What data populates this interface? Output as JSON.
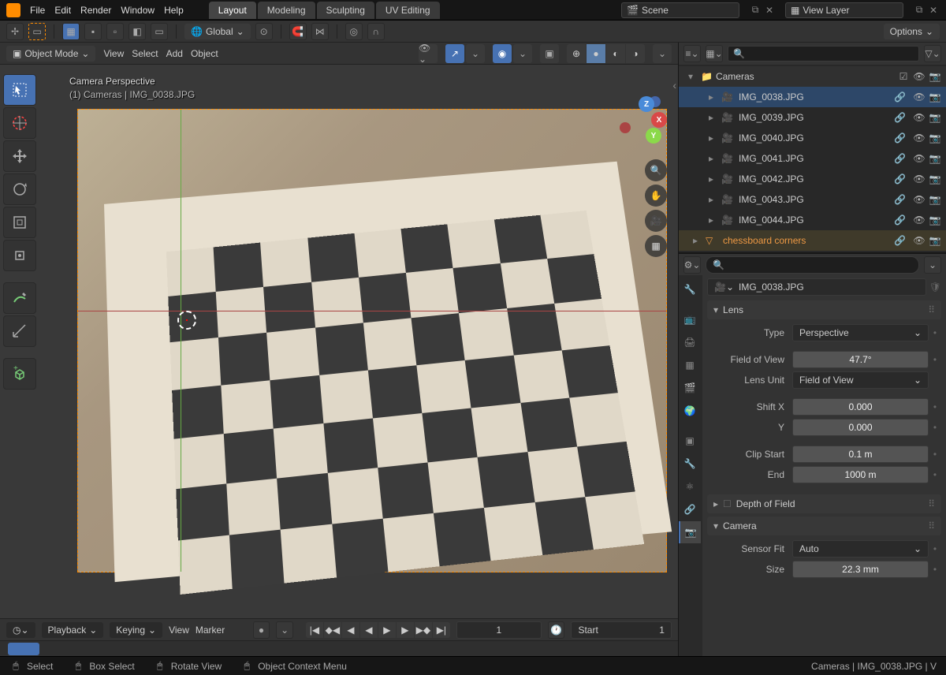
{
  "top_menu": {
    "items": [
      "File",
      "Edit",
      "Render",
      "Window",
      "Help"
    ],
    "tabs": [
      "Layout",
      "Modeling",
      "Sculpting",
      "UV Editing"
    ],
    "active_tab": 0,
    "scene_label": "Scene",
    "view_layer_label": "View Layer"
  },
  "toolbar": {
    "orientation": "Global",
    "options_label": "Options"
  },
  "viewport_header": {
    "mode": "Object Mode",
    "menus": [
      "View",
      "Select",
      "Add",
      "Object"
    ]
  },
  "viewport": {
    "title": "Camera Perspective",
    "subtitle": "(1) Cameras | IMG_0038.JPG"
  },
  "outliner": {
    "collection": "Cameras",
    "items": [
      {
        "name": "IMG_0038.JPG",
        "selected": true
      },
      {
        "name": "IMG_0039.JPG",
        "selected": false
      },
      {
        "name": "IMG_0040.JPG",
        "selected": false
      },
      {
        "name": "IMG_0041.JPG",
        "selected": false
      },
      {
        "name": "IMG_0042.JPG",
        "selected": false
      },
      {
        "name": "IMG_0043.JPG",
        "selected": false
      },
      {
        "name": "IMG_0044.JPG",
        "selected": false
      }
    ],
    "mesh_item": "chessboard corners"
  },
  "properties": {
    "object_name": "IMG_0038.JPG",
    "lens_panel": "Lens",
    "type_label": "Type",
    "type_value": "Perspective",
    "fov_label": "Field of View",
    "fov_value": "47.7°",
    "lens_unit_label": "Lens Unit",
    "lens_unit_value": "Field of View",
    "shift_x_label": "Shift X",
    "shift_x_value": "0.000",
    "shift_y_label": "Y",
    "shift_y_value": "0.000",
    "clip_start_label": "Clip Start",
    "clip_start_value": "0.1 m",
    "clip_end_label": "End",
    "clip_end_value": "1000 m",
    "dof_panel": "Depth of Field",
    "camera_panel": "Camera",
    "sensor_fit_label": "Sensor Fit",
    "sensor_fit_value": "Auto",
    "size_label": "Size",
    "size_value": "22.3 mm"
  },
  "timeline": {
    "playback": "Playback",
    "keying": "Keying",
    "view": "View",
    "marker": "Marker",
    "current_frame": "1",
    "start_label": "Start",
    "start_value": "1"
  },
  "statusbar": {
    "select": "Select",
    "box_select": "Box Select",
    "rotate_view": "Rotate View",
    "context_menu": "Object Context Menu",
    "path": "Cameras | IMG_0038.JPG | V"
  }
}
